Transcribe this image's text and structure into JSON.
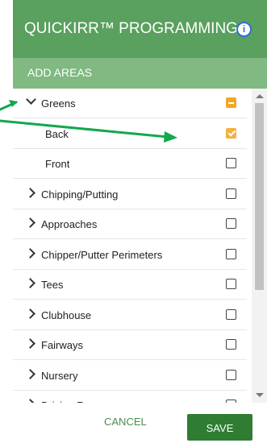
{
  "header": {
    "title": "QUICKIRR™ PROGRAMMING",
    "info_icon": "info-icon"
  },
  "subheader": {
    "label": "ADD AREAS"
  },
  "areas": [
    {
      "label": "Greens",
      "expander": "chevron-down-icon",
      "state": "partial",
      "sub": false
    },
    {
      "label": "Back",
      "expander": "",
      "state": "checked",
      "sub": true
    },
    {
      "label": "Front",
      "expander": "",
      "state": "unchecked",
      "sub": true
    },
    {
      "label": "Chipping/Putting",
      "expander": "chevron-right-icon",
      "state": "unchecked",
      "sub": false
    },
    {
      "label": "Approaches",
      "expander": "chevron-right-icon",
      "state": "unchecked",
      "sub": false
    },
    {
      "label": "Chipper/Putter Perimeters",
      "expander": "chevron-right-icon",
      "state": "unchecked",
      "sub": false
    },
    {
      "label": "Tees",
      "expander": "chevron-right-icon",
      "state": "unchecked",
      "sub": false
    },
    {
      "label": "Clubhouse",
      "expander": "chevron-right-icon",
      "state": "unchecked",
      "sub": false
    },
    {
      "label": "Fairways",
      "expander": "chevron-right-icon",
      "state": "unchecked",
      "sub": false
    },
    {
      "label": "Nursery",
      "expander": "chevron-right-icon",
      "state": "unchecked",
      "sub": false
    },
    {
      "label": "Driving Range",
      "expander": "chevron-right-icon",
      "state": "unchecked",
      "sub": false
    }
  ],
  "footer": {
    "cancel_label": "CANCEL",
    "save_label": "SAVE"
  },
  "colors": {
    "header": "#5aa05e",
    "subheader": "#80b982",
    "accent": "#f5a623",
    "save": "#2e7d32",
    "annotation_arrow": "#12a84c"
  }
}
